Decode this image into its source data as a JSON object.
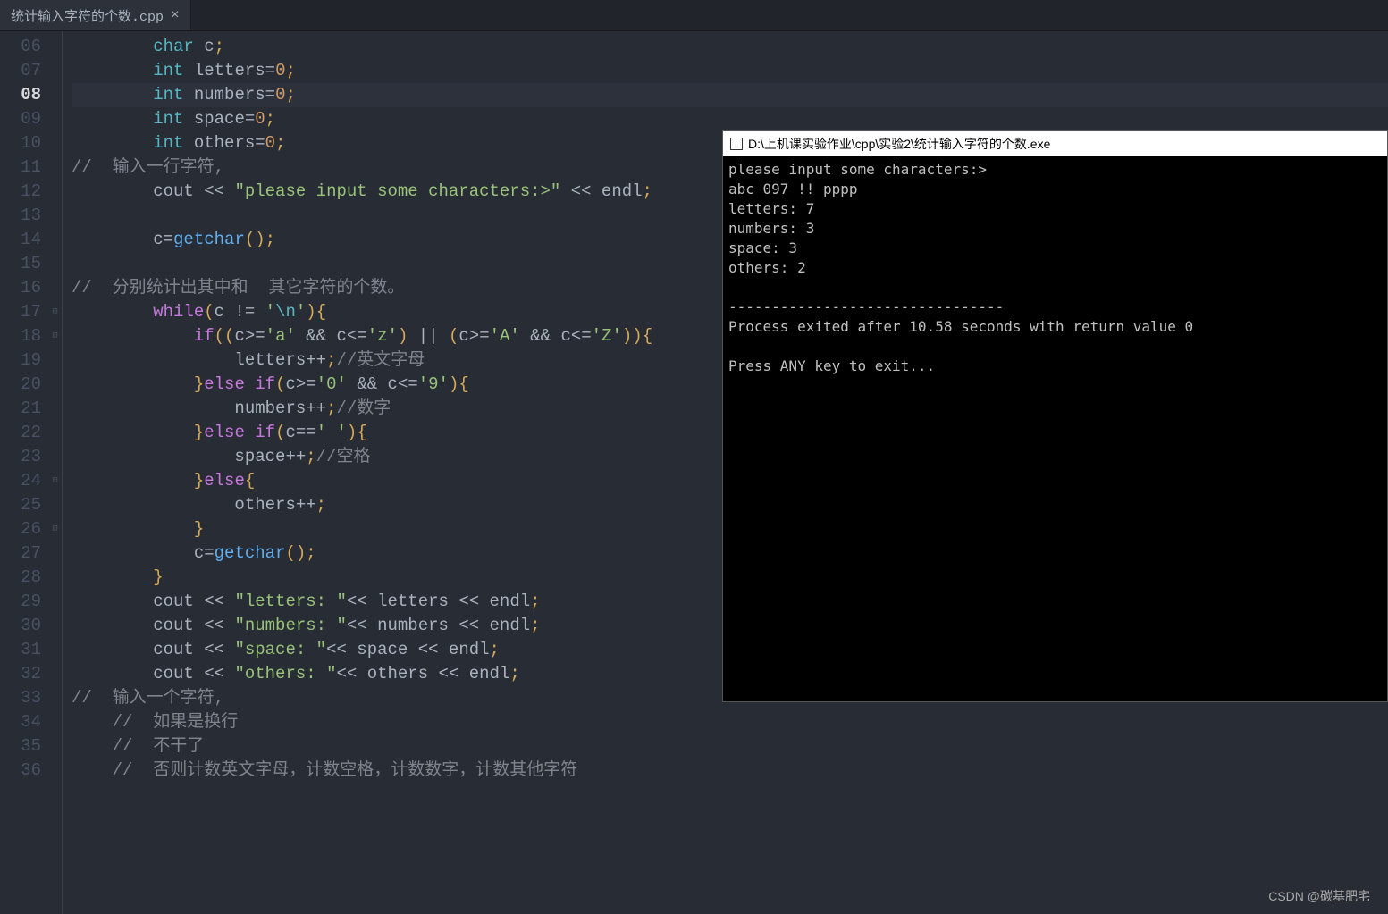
{
  "tab": {
    "filename": "统计输入字符的个数.cpp",
    "close_icon": "×"
  },
  "gutter": {
    "lines": [
      "06",
      "07",
      "08",
      "09",
      "10",
      "11",
      "12",
      "13",
      "14",
      "15",
      "16",
      "17",
      "18",
      "19",
      "20",
      "21",
      "22",
      "23",
      "24",
      "25",
      "26",
      "27",
      "28",
      "29",
      "30",
      "31",
      "32",
      "33",
      "34",
      "35",
      "36"
    ],
    "active_line_index": 2
  },
  "fold": {
    "marks": {
      "11": "⊟",
      "12": "⊟",
      "18": "⊟",
      "20": "⊟"
    }
  },
  "code": {
    "lines": [
      {
        "n": "06",
        "t": [
          [
            "",
            "        "
          ],
          [
            "type",
            "char"
          ],
          [
            "",
            " c"
          ],
          [
            "punct",
            ";"
          ]
        ]
      },
      {
        "n": "07",
        "t": [
          [
            "",
            "        "
          ],
          [
            "type",
            "int"
          ],
          [
            "",
            " letters"
          ],
          [
            "op",
            "="
          ],
          [
            "num",
            "0"
          ],
          [
            "punct",
            ";"
          ]
        ]
      },
      {
        "n": "08",
        "hl": true,
        "t": [
          [
            "",
            "        "
          ],
          [
            "type",
            "int"
          ],
          [
            "",
            " numbers"
          ],
          [
            "op",
            "="
          ],
          [
            "num",
            "0"
          ],
          [
            "punct",
            ";"
          ]
        ]
      },
      {
        "n": "09",
        "t": [
          [
            "",
            "        "
          ],
          [
            "type",
            "int"
          ],
          [
            "",
            " space"
          ],
          [
            "op",
            "="
          ],
          [
            "num",
            "0"
          ],
          [
            "punct",
            ";"
          ]
        ]
      },
      {
        "n": "10",
        "t": [
          [
            "",
            "        "
          ],
          [
            "type",
            "int"
          ],
          [
            "",
            " others"
          ],
          [
            "op",
            "="
          ],
          [
            "num",
            "0"
          ],
          [
            "punct",
            ";"
          ]
        ]
      },
      {
        "n": "11",
        "t": [
          [
            "comment",
            "//  "
          ],
          [
            "comment",
            "输入一行字符,"
          ]
        ]
      },
      {
        "n": "12",
        "t": [
          [
            "",
            "        cout "
          ],
          [
            "op",
            "<<"
          ],
          [
            "",
            " "
          ],
          [
            "str",
            "\"please input some characters:>\""
          ],
          [
            "",
            " "
          ],
          [
            "op",
            "<<"
          ],
          [
            "",
            " endl"
          ],
          [
            "punct",
            ";"
          ]
        ]
      },
      {
        "n": "13",
        "t": [
          [
            "",
            ""
          ]
        ]
      },
      {
        "n": "14",
        "t": [
          [
            "",
            "        c"
          ],
          [
            "op",
            "="
          ],
          [
            "fn",
            "getchar"
          ],
          [
            "punct",
            "()"
          ],
          [
            "punct",
            ";"
          ]
        ]
      },
      {
        "n": "15",
        "t": [
          [
            "",
            ""
          ]
        ]
      },
      {
        "n": "16",
        "t": [
          [
            "comment",
            "//  "
          ],
          [
            "comment",
            "分别统计出其中和  其它字符的个数。"
          ]
        ]
      },
      {
        "n": "17",
        "t": [
          [
            "",
            "        "
          ],
          [
            "kw",
            "while"
          ],
          [
            "punct",
            "("
          ],
          [
            "",
            "c "
          ],
          [
            "op",
            "!="
          ],
          [
            "",
            " "
          ],
          [
            "str",
            "'"
          ],
          [
            "esc",
            "\\n"
          ],
          [
            "str",
            "'"
          ],
          [
            "punct",
            ")"
          ],
          [
            "punct",
            "{"
          ]
        ]
      },
      {
        "n": "18",
        "t": [
          [
            "",
            "            "
          ],
          [
            "kw",
            "if"
          ],
          [
            "punct",
            "(("
          ],
          [
            "",
            "c"
          ],
          [
            "op",
            ">="
          ],
          [
            "str",
            "'a'"
          ],
          [
            "",
            " "
          ],
          [
            "op",
            "&&"
          ],
          [
            "",
            " c"
          ],
          [
            "op",
            "<="
          ],
          [
            "str",
            "'z'"
          ],
          [
            "punct",
            ")"
          ],
          [
            "",
            " "
          ],
          [
            "op",
            "||"
          ],
          [
            "",
            " "
          ],
          [
            "punct",
            "("
          ],
          [
            "",
            "c"
          ],
          [
            "op",
            ">="
          ],
          [
            "str",
            "'A'"
          ],
          [
            "",
            " "
          ],
          [
            "op",
            "&&"
          ],
          [
            "",
            " c"
          ],
          [
            "op",
            "<="
          ],
          [
            "str",
            "'Z'"
          ],
          [
            "punct",
            "))"
          ],
          [
            "punct",
            "{"
          ]
        ]
      },
      {
        "n": "19",
        "t": [
          [
            "",
            "                letters"
          ],
          [
            "op",
            "++"
          ],
          [
            "punct",
            ";"
          ],
          [
            "comment",
            "//英文字母"
          ]
        ]
      },
      {
        "n": "20",
        "t": [
          [
            "",
            "            "
          ],
          [
            "punct",
            "}"
          ],
          [
            "kw",
            "else"
          ],
          [
            "",
            " "
          ],
          [
            "kw",
            "if"
          ],
          [
            "punct",
            "("
          ],
          [
            "",
            "c"
          ],
          [
            "op",
            ">="
          ],
          [
            "str",
            "'0'"
          ],
          [
            "",
            " "
          ],
          [
            "op",
            "&&"
          ],
          [
            "",
            " c"
          ],
          [
            "op",
            "<="
          ],
          [
            "str",
            "'9'"
          ],
          [
            "punct",
            ")"
          ],
          [
            "punct",
            "{"
          ]
        ]
      },
      {
        "n": "21",
        "t": [
          [
            "",
            "                numbers"
          ],
          [
            "op",
            "++"
          ],
          [
            "punct",
            ";"
          ],
          [
            "comment",
            "//数字"
          ]
        ]
      },
      {
        "n": "22",
        "t": [
          [
            "",
            "            "
          ],
          [
            "punct",
            "}"
          ],
          [
            "kw",
            "else"
          ],
          [
            "",
            " "
          ],
          [
            "kw",
            "if"
          ],
          [
            "punct",
            "("
          ],
          [
            "",
            "c"
          ],
          [
            "op",
            "=="
          ],
          [
            "str",
            "' '"
          ],
          [
            "punct",
            ")"
          ],
          [
            "punct",
            "{"
          ]
        ]
      },
      {
        "n": "23",
        "t": [
          [
            "",
            "                space"
          ],
          [
            "op",
            "++"
          ],
          [
            "punct",
            ";"
          ],
          [
            "comment",
            "//空格"
          ]
        ]
      },
      {
        "n": "24",
        "t": [
          [
            "",
            "            "
          ],
          [
            "punct",
            "}"
          ],
          [
            "kw",
            "else"
          ],
          [
            "punct",
            "{"
          ]
        ]
      },
      {
        "n": "25",
        "t": [
          [
            "",
            "                others"
          ],
          [
            "op",
            "++"
          ],
          [
            "punct",
            ";"
          ]
        ]
      },
      {
        "n": "26",
        "t": [
          [
            "",
            "            "
          ],
          [
            "punct",
            "}"
          ]
        ]
      },
      {
        "n": "27",
        "t": [
          [
            "",
            "            c"
          ],
          [
            "op",
            "="
          ],
          [
            "fn",
            "getchar"
          ],
          [
            "punct",
            "()"
          ],
          [
            "punct",
            ";"
          ]
        ]
      },
      {
        "n": "28",
        "t": [
          [
            "",
            "        "
          ],
          [
            "punct",
            "}"
          ]
        ]
      },
      {
        "n": "29",
        "t": [
          [
            "",
            "        cout "
          ],
          [
            "op",
            "<<"
          ],
          [
            "",
            " "
          ],
          [
            "str",
            "\"letters: \""
          ],
          [
            "op",
            "<<"
          ],
          [
            "",
            " letters "
          ],
          [
            "op",
            "<<"
          ],
          [
            "",
            " endl"
          ],
          [
            "punct",
            ";"
          ]
        ]
      },
      {
        "n": "30",
        "t": [
          [
            "",
            "        cout "
          ],
          [
            "op",
            "<<"
          ],
          [
            "",
            " "
          ],
          [
            "str",
            "\"numbers: \""
          ],
          [
            "op",
            "<<"
          ],
          [
            "",
            " numbers "
          ],
          [
            "op",
            "<<"
          ],
          [
            "",
            " endl"
          ],
          [
            "punct",
            ";"
          ]
        ]
      },
      {
        "n": "31",
        "t": [
          [
            "",
            "        cout "
          ],
          [
            "op",
            "<<"
          ],
          [
            "",
            " "
          ],
          [
            "str",
            "\"space: \""
          ],
          [
            "op",
            "<<"
          ],
          [
            "",
            " space "
          ],
          [
            "op",
            "<<"
          ],
          [
            "",
            " endl"
          ],
          [
            "punct",
            ";"
          ]
        ]
      },
      {
        "n": "32",
        "t": [
          [
            "",
            "        cout "
          ],
          [
            "op",
            "<<"
          ],
          [
            "",
            " "
          ],
          [
            "str",
            "\"others: \""
          ],
          [
            "op",
            "<<"
          ],
          [
            "",
            " others "
          ],
          [
            "op",
            "<<"
          ],
          [
            "",
            " endl"
          ],
          [
            "punct",
            ";"
          ]
        ]
      },
      {
        "n": "33",
        "t": [
          [
            "comment",
            "//  输入一个字符,"
          ]
        ]
      },
      {
        "n": "34",
        "t": [
          [
            "comment",
            "    //  如果是换行"
          ]
        ]
      },
      {
        "n": "35",
        "t": [
          [
            "comment",
            "    //  不干了"
          ]
        ]
      },
      {
        "n": "36",
        "t": [
          [
            "comment",
            "    //  否则计数英文字母，计数空格，计数数字，计数其他字符"
          ]
        ]
      }
    ]
  },
  "console": {
    "title": "D:\\上机课实验作业\\cpp\\实验2\\统计输入字符的个数.exe",
    "output": "please input some characters:>\nabc 097 !! pppp\nletters: 7\nnumbers: 3\nspace: 3\nothers: 2\n\n--------------------------------\nProcess exited after 10.58 seconds with return value 0\n\nPress ANY key to exit..."
  },
  "watermark": "CSDN @碳基肥宅"
}
